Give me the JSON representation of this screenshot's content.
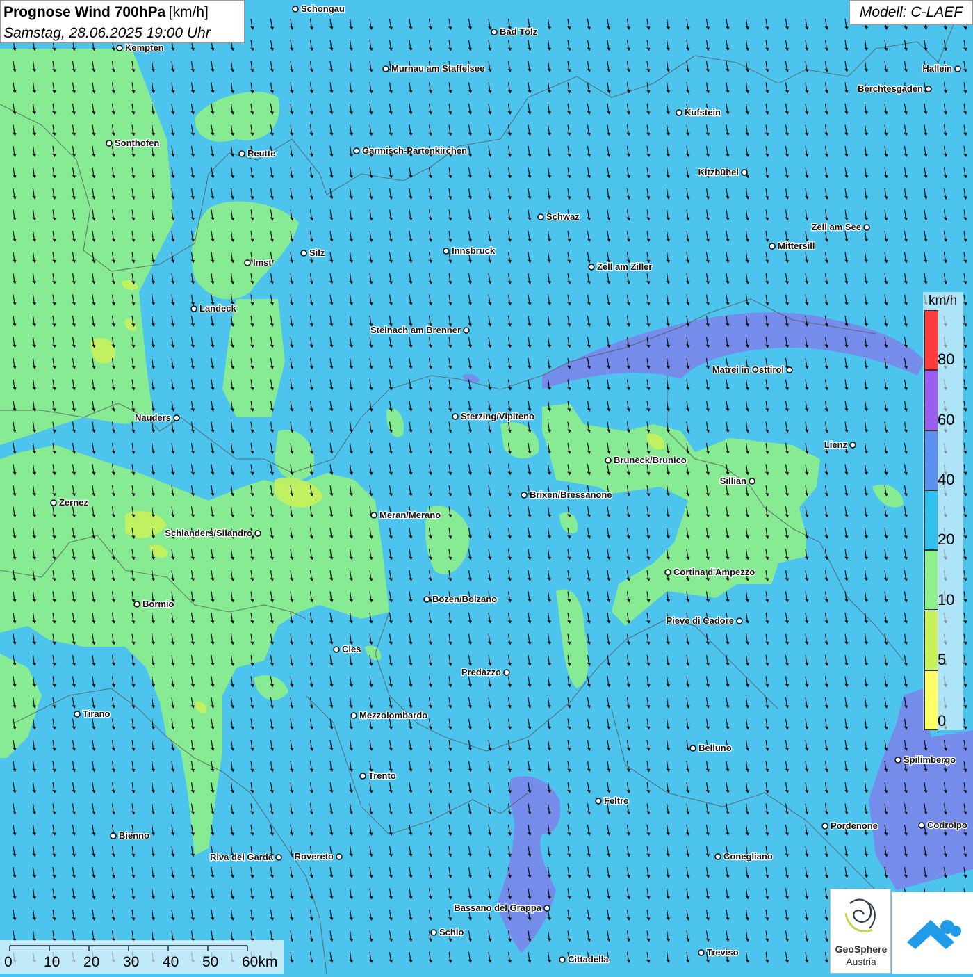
{
  "title": {
    "main": "Prognose Wind 700hPa",
    "unit": "[km/h]",
    "datetime": "Samstag, 28.06.2025 19:00 Uhr"
  },
  "model": "Modell: C-LAEF",
  "legend": {
    "unit": "km/h",
    "items": [
      {
        "label": "80",
        "color": "#ff3b3b"
      },
      {
        "label": "60",
        "color": "#9b5cf0"
      },
      {
        "label": "40",
        "color": "#5b8ff0"
      },
      {
        "label": "20",
        "color": "#2ec0ee"
      },
      {
        "label": "10",
        "color": "#8ef08a"
      },
      {
        "label": "5",
        "color": "#c8f25a"
      },
      {
        "label": "0",
        "color": "#ffff66"
      }
    ]
  },
  "scale_bar": {
    "labels": [
      "0",
      "10",
      "20",
      "30",
      "40",
      "50",
      "60km"
    ]
  },
  "logos": {
    "geosphere_line1": "GeoSphere",
    "geosphere_line2": "Austria"
  },
  "cities": [
    {
      "name": "Schongau"
    },
    {
      "name": "Bad Tölz"
    },
    {
      "name": "Kempten"
    },
    {
      "name": "Murnau am Staffelsee"
    },
    {
      "name": "Hallein"
    },
    {
      "name": "Berchtesgaden"
    },
    {
      "name": "Kufstein"
    },
    {
      "name": "Sonthofen"
    },
    {
      "name": "Reutte"
    },
    {
      "name": "Garmisch-Partenkirchen"
    },
    {
      "name": "Kitzbühel"
    },
    {
      "name": "Schwaz"
    },
    {
      "name": "Zell am See"
    },
    {
      "name": "Mittersill"
    },
    {
      "name": "Innsbruck"
    },
    {
      "name": "Silz"
    },
    {
      "name": "Imst"
    },
    {
      "name": "Zell am Ziller"
    },
    {
      "name": "Landeck"
    },
    {
      "name": "Steinach am Brenner"
    },
    {
      "name": "Matrei in Osttirol"
    },
    {
      "name": "Nauders"
    },
    {
      "name": "Sterzing/Vipiteno"
    },
    {
      "name": "Lienz"
    },
    {
      "name": "Bruneck/Brunico"
    },
    {
      "name": "Sillian"
    },
    {
      "name": "Zernez"
    },
    {
      "name": "Brixen/Bressanone"
    },
    {
      "name": "Meran/Merano"
    },
    {
      "name": "Schlanders/Silandro"
    },
    {
      "name": "Cortina d'Ampezzo"
    },
    {
      "name": "Bozen/Bolzano"
    },
    {
      "name": "Bormio"
    },
    {
      "name": "Pieve di Cadore"
    },
    {
      "name": "Cles"
    },
    {
      "name": "Predazzo"
    },
    {
      "name": "Tirano"
    },
    {
      "name": "Mezzolombardo"
    },
    {
      "name": "Belluno"
    },
    {
      "name": "Spilimbergo"
    },
    {
      "name": "Trento"
    },
    {
      "name": "Feltre"
    },
    {
      "name": "Pordenone"
    },
    {
      "name": "Codroipo"
    },
    {
      "name": "Bienno"
    },
    {
      "name": "Riva del Garda"
    },
    {
      "name": "Rovereto"
    },
    {
      "name": "Conegliano"
    },
    {
      "name": "Bassano del Grappa"
    },
    {
      "name": "Schio"
    },
    {
      "name": "Treviso"
    },
    {
      "name": "Cittadella"
    }
  ]
}
